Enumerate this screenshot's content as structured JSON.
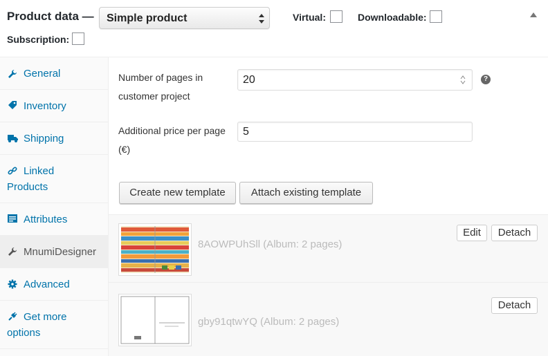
{
  "header": {
    "title": "Product data —",
    "product_type": "Simple product",
    "virtual_label": "Virtual:",
    "downloadable_label": "Downloadable:",
    "subscription_label": "Subscription:"
  },
  "sidebar": {
    "items": [
      {
        "label": "General",
        "icon": "wrench-icon",
        "active": false
      },
      {
        "label": "Inventory",
        "icon": "tag-icon",
        "active": false
      },
      {
        "label": "Shipping",
        "icon": "truck-icon",
        "active": false
      },
      {
        "label": "Linked Products",
        "icon": "link-icon",
        "active": false
      },
      {
        "label": "Attributes",
        "icon": "list-icon",
        "active": false
      },
      {
        "label": "MnumiDesigner",
        "icon": "wrench-icon",
        "active": true
      },
      {
        "label": "Advanced",
        "icon": "gear-icon",
        "active": false
      },
      {
        "label": "Get more options",
        "icon": "plugin-icon",
        "active": false
      }
    ]
  },
  "fields": {
    "pages_label": "Number of pages in customer project",
    "pages_value": "20",
    "price_label": "Additional price per page (€)",
    "price_value": "5"
  },
  "buttons": {
    "create_template": "Create new template",
    "attach_template": "Attach existing template"
  },
  "templates": [
    {
      "name": "8AOWPUhSll (Album: 2 pages)",
      "edit_label": "Edit",
      "detach_label": "Detach"
    },
    {
      "name": "gby91qtwYQ (Album: 2 pages)",
      "detach_label": "Detach"
    }
  ],
  "colors": {
    "link": "#0073aa",
    "active_tab_bg": "#eeeeee",
    "muted_text": "#bbbbbb"
  }
}
